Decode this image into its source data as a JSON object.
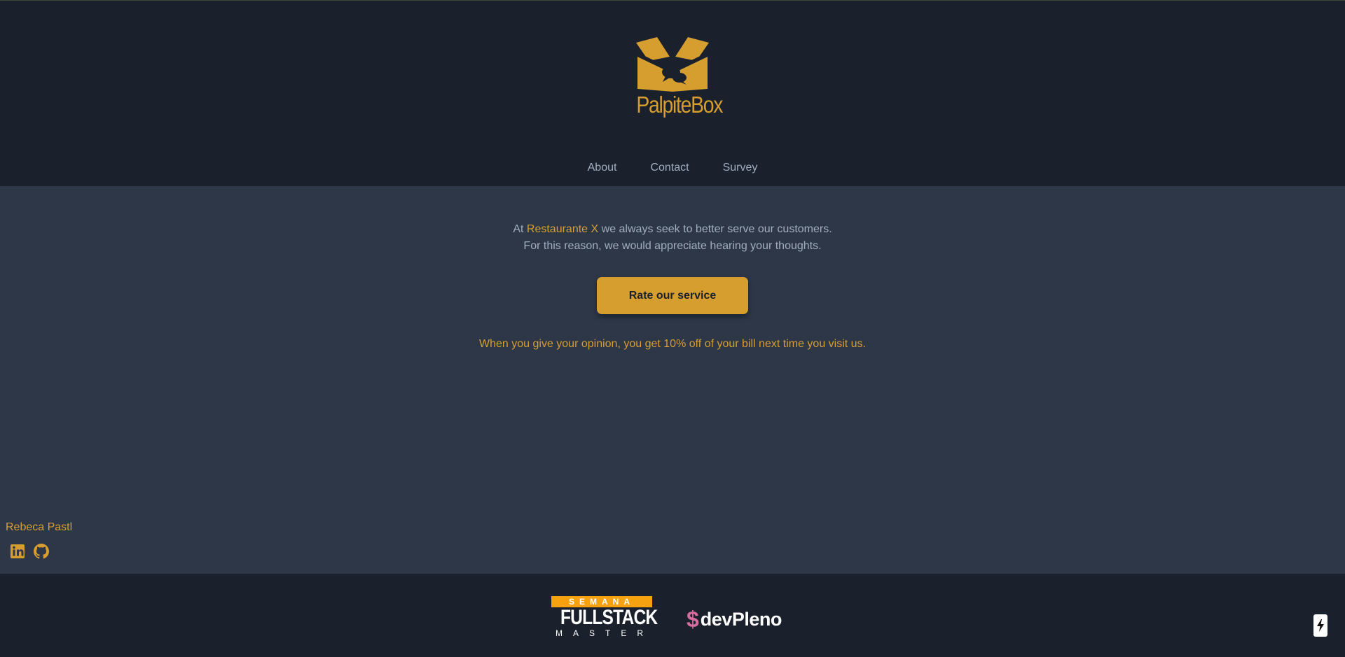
{
  "header": {
    "logo_text": "PalpiteBox",
    "nav": [
      {
        "label": "About"
      },
      {
        "label": "Contact"
      },
      {
        "label": "Survey"
      }
    ]
  },
  "main": {
    "intro_prefix": "At ",
    "restaurant_name": "Restaurante X",
    "intro_suffix": " we always seek to better serve our customers.",
    "intro_line2": "For this reason, we would appreciate hearing your thoughts.",
    "cta_label": "Rate our service",
    "promo_text": "When you give your opinion, you get 10% off of your bill next time you visit us."
  },
  "author": {
    "name": "Rebeca Pastl",
    "social_icons": [
      "linkedin-icon",
      "github-icon"
    ]
  },
  "footer": {
    "fullstack_top": "SEMANA",
    "fullstack_mid": "FULLSTACK",
    "fullstack_bottom": "MASTER",
    "devpleno_symbol": "$",
    "devpleno_text": "devPleno"
  },
  "colors": {
    "accent": "#d69e2e",
    "header_bg": "#1a202c",
    "main_bg": "#2d3748",
    "text": "#a0aec0",
    "fullstack_orange": "#f5a110",
    "devpleno_pink": "#d86c9e"
  }
}
